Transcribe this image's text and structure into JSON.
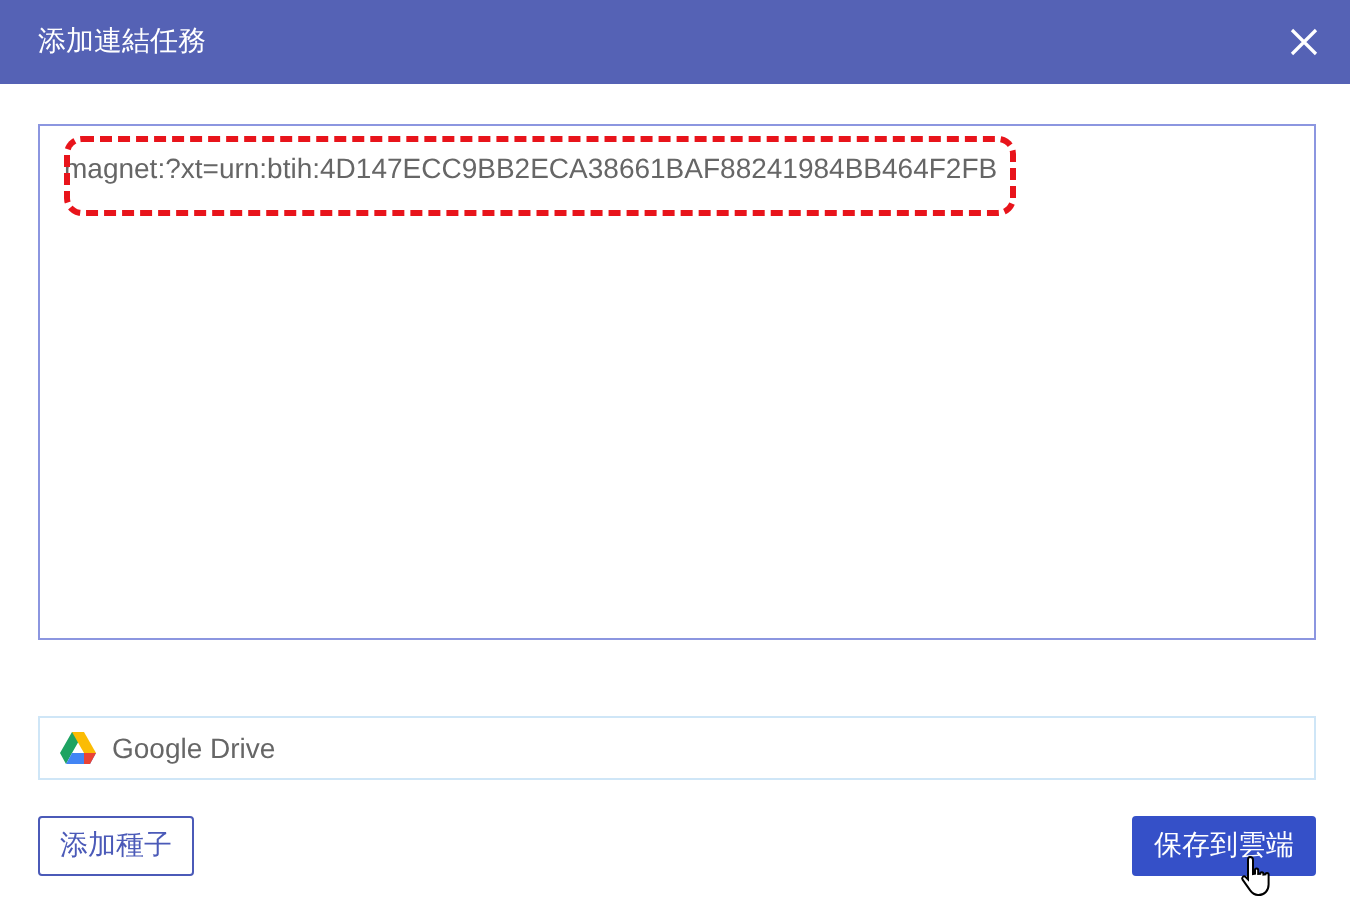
{
  "window": {
    "title": "添加連結任務"
  },
  "link_field": {
    "value": "magnet:?xt=urn:btih:4D147ECC9BB2ECA38661BAF88241984BB464F2FB",
    "highlighted": true
  },
  "destination": {
    "label": "Google Drive"
  },
  "buttons": [
    {
      "label": "添加種子",
      "kind": "secondary"
    },
    {
      "label": "保存到雲端",
      "kind": "primary"
    }
  ]
}
